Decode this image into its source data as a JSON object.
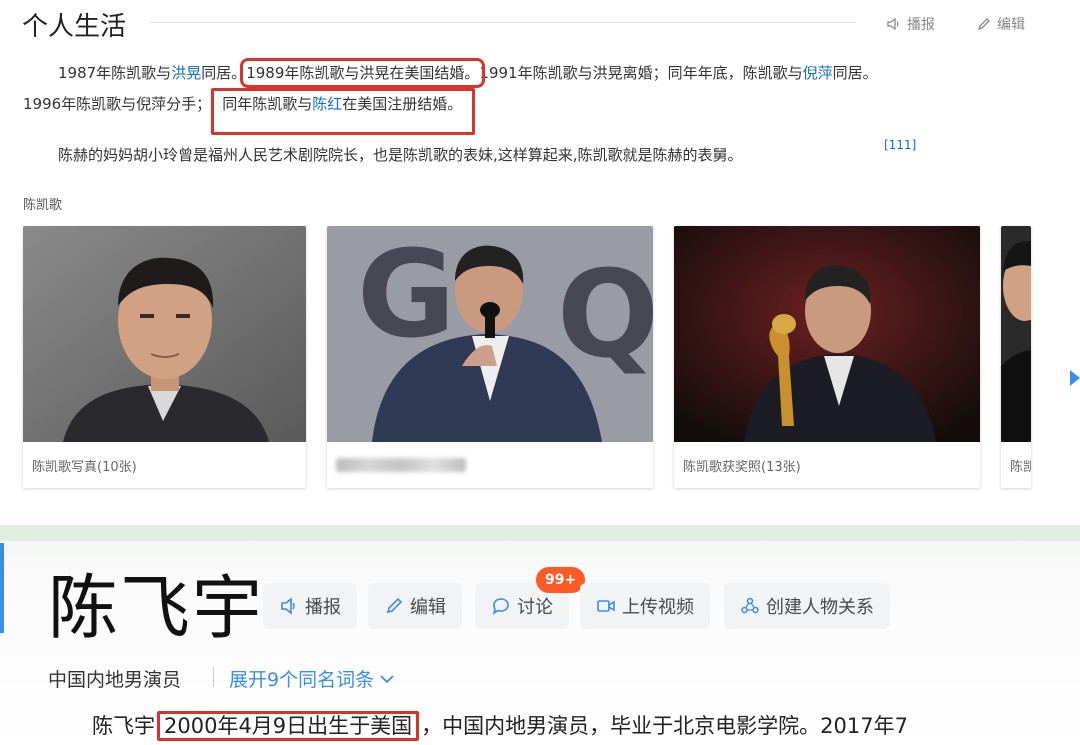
{
  "section": {
    "title": "个人生活",
    "report_label": "播报",
    "edit_label": "编辑"
  },
  "paragraph1": {
    "line1_a": "1987年陈凯歌与",
    "line1_link1": "洪晃",
    "line1_b": "同居。",
    "line1_highlight": "1989年陈凯歌与洪晃在美国结婚。",
    "line1_c": "1991年陈凯歌与洪晃离婚；同年年底，陈凯歌与",
    "line1_link2": "倪萍",
    "line1_d": "同居。",
    "line2_a": "1996年陈凯歌与倪萍分手；",
    "line2_hl_a": "同年陈凯歌与",
    "line2_hl_link": "陈红",
    "line2_hl_b": "在美国注册结婚。"
  },
  "paragraph2": {
    "text": "陈赫的妈妈胡小玲曾是福州人民艺术剧院院长，也是陈凯歌的表妹,这样算起来,陈凯歌就是陈赫的表舅。",
    "ref": "[111]"
  },
  "album": {
    "title": "陈凯歌",
    "cards": [
      {
        "caption": "陈凯歌写真(10张)"
      },
      {
        "caption": ""
      },
      {
        "caption": "陈凯歌获奖照(13张)"
      },
      {
        "caption": "陈凯"
      }
    ]
  },
  "person": {
    "name": "陈飞宇",
    "buttons": {
      "report": "播报",
      "edit": "编辑",
      "discuss": "讨论",
      "upload": "上传视频",
      "relation": "创建人物关系"
    },
    "badge": "99+",
    "subtitle": "中国内地男演员",
    "expand": "展开9个同名词条",
    "bio_a": "陈飞宇",
    "bio_highlight": "2000年4月9日出生于美国",
    "bio_b": "，中国内地男演员，毕业于北京电影学院。2017年7"
  },
  "colors": {
    "link": "#136ec2",
    "highlight_box": "#d9342b",
    "accent_blue": "#3a8ee6",
    "badge": "#ff5a26"
  }
}
